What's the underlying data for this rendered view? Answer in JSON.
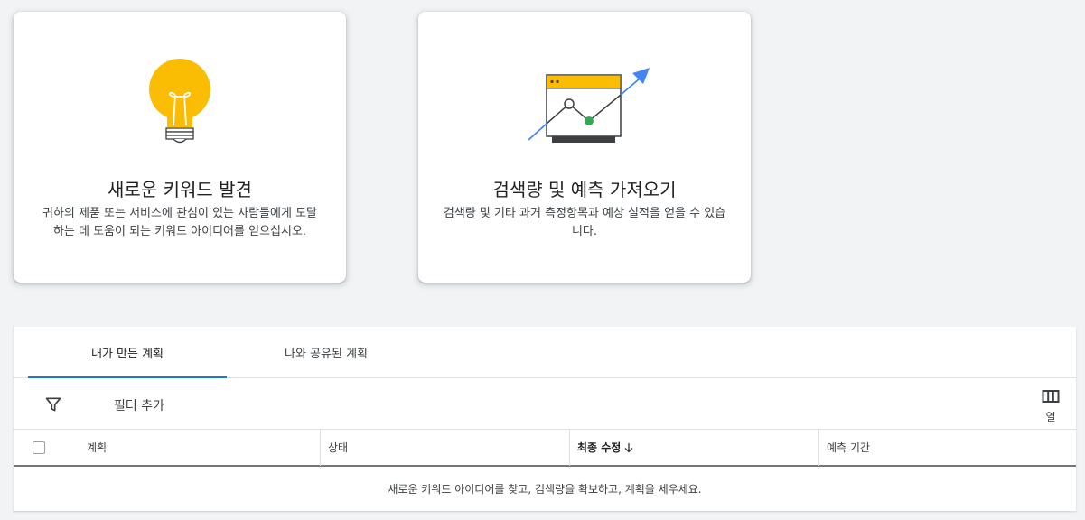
{
  "cards": {
    "discover": {
      "title": "새로운 키워드 발견",
      "description_line1": "귀하의 제품 또는 서비스에 관심이 있는 사람들에게 도달",
      "description_line2": "하는 데 도움이 되는 키워드 아이디어를 얻으십시오."
    },
    "forecast": {
      "title": "검색량 및 예측 가져오기",
      "description_line1": "검색량 및 기타 과거 측정항목과 예상 실적을 얻을 수 있습",
      "description_line2": "니다."
    }
  },
  "tabs": [
    {
      "label": "내가 만든 계획",
      "active": true
    },
    {
      "label": "나와 공유된 계획",
      "active": false
    }
  ],
  "filter": {
    "icon": "filter-icon",
    "label": "필터 추가"
  },
  "columns_button": {
    "icon": "columns-icon",
    "label": "열"
  },
  "table": {
    "headers": {
      "plan": "계획",
      "status": "상태",
      "last_modified": "최종 수정",
      "forecast_period": "예측 기간"
    },
    "sort": {
      "column": "last_modified",
      "direction": "descending",
      "icon": "arrow-down-icon"
    },
    "empty_message": "새로운 키워드 아이디어를 찾고, 검색량을 확보하고, 계획을 세우세요."
  },
  "colors": {
    "accent": "#1a73e8",
    "bulb": "#fbbc04",
    "chart_point": "#34a853",
    "background": "#f1f3f4"
  }
}
